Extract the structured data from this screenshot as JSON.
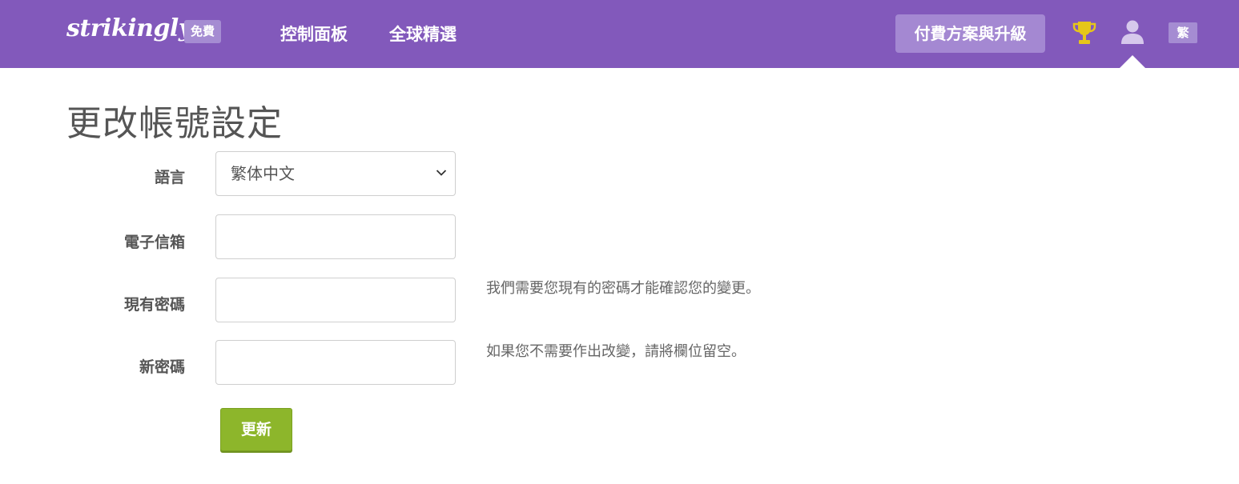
{
  "header": {
    "logo": "strikingly",
    "plan_badge": "免費",
    "nav": [
      "控制面板",
      "全球精選"
    ],
    "upgrade_label": "付費方案與升級",
    "language_badge": "繁",
    "icons": [
      "trophy-icon",
      "user-icon"
    ],
    "colors": {
      "bar": "#8259bb",
      "badge": "#a58cd2",
      "trophy": "#e6c619"
    }
  },
  "page": {
    "title": "更改帳號設定"
  },
  "form": {
    "language": {
      "label": "語言",
      "selected": "繁体中文"
    },
    "email": {
      "label": "電子信箱",
      "value": "",
      "placeholder": ""
    },
    "current_password": {
      "label": "現有密碼",
      "value": "",
      "hint": "我們需要您現有的密碼才能確認您的變更。"
    },
    "new_password": {
      "label": "新密碼",
      "value": "",
      "hint": "如果您不需要作出改變，請將欄位留空。"
    },
    "submit_label": "更新",
    "colors": {
      "submit": "#8db62b"
    }
  }
}
